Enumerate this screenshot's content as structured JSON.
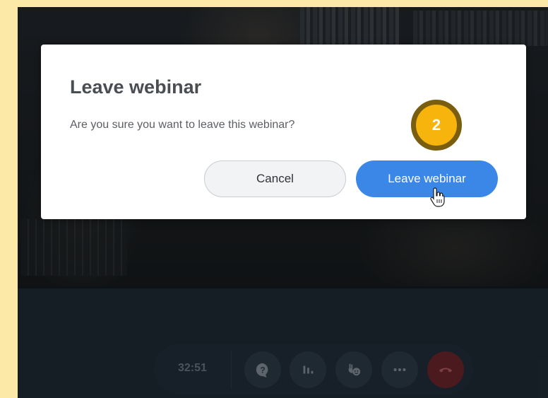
{
  "dialog": {
    "title": "Leave webinar",
    "message": "Are you sure you want to leave this webinar?",
    "cancel_label": "Cancel",
    "leave_label": "Leave webinar"
  },
  "annotation": {
    "step_number": "2"
  },
  "controls": {
    "timer": "32:51",
    "buttons": [
      {
        "icon": "question-icon"
      },
      {
        "icon": "poll-icon"
      },
      {
        "icon": "raise-hand-icon"
      },
      {
        "icon": "more-icon"
      },
      {
        "icon": "hang-up-icon"
      }
    ]
  },
  "colors": {
    "accent": "#3a87e8",
    "badge": "#f6b40c",
    "hangup": "#6e2125",
    "border_frame": "#fde9a7"
  }
}
